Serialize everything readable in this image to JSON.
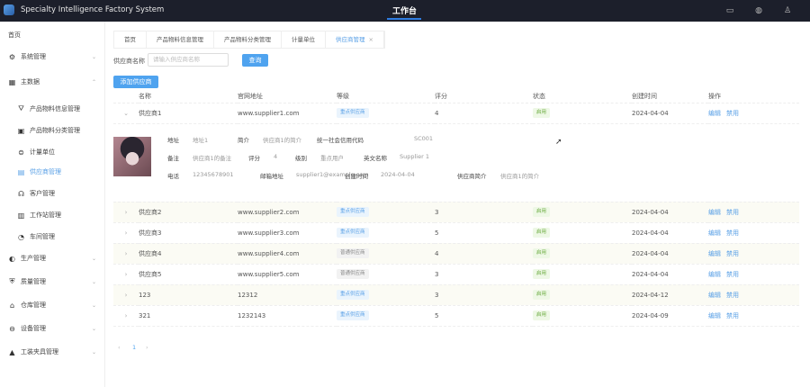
{
  "header": {
    "app_title": "Specialty Intelligence Factory System",
    "center_tab": "工作台",
    "icons": [
      "screen-icon",
      "globe-icon",
      "user-icon"
    ]
  },
  "sidebar": {
    "items": [
      {
        "label": "首页",
        "icon": ""
      },
      {
        "label": "系统管理",
        "icon": "gear-icon",
        "chev": "⌄"
      },
      {
        "label": "主数据",
        "icon": "grid-icon",
        "chev": "⌃"
      },
      {
        "label": "产品物料信息管理",
        "icon": "filter-icon",
        "sub": true
      },
      {
        "label": "产品物料分类管理",
        "icon": "folder-icon",
        "sub": true
      },
      {
        "label": "计量单位",
        "icon": "database-icon",
        "sub": true
      },
      {
        "label": "供应商管理",
        "icon": "supplier-icon",
        "sub": true,
        "active": true
      },
      {
        "label": "客户管理",
        "icon": "headset-icon",
        "sub": true
      },
      {
        "label": "工作站管理",
        "icon": "workstation-icon",
        "sub": true
      },
      {
        "label": "车间管理",
        "icon": "dashboard-icon",
        "sub": true
      },
      {
        "label": "生产管理",
        "icon": "toggle-icon",
        "chev": "⌄"
      },
      {
        "label": "质量管理",
        "icon": "shield-icon",
        "chev": "⌄"
      },
      {
        "label": "仓库管理",
        "icon": "warehouse-icon",
        "chev": "⌄"
      },
      {
        "label": "设备管理",
        "icon": "device-icon",
        "chev": "⌄"
      },
      {
        "label": "工装夹具管理",
        "icon": "tool-icon",
        "chev": "⌄"
      }
    ]
  },
  "tabs": [
    {
      "label": "首页"
    },
    {
      "label": "产品物料信息管理"
    },
    {
      "label": "产品物料分类管理"
    },
    {
      "label": "计量单位"
    },
    {
      "label": "供应商管理",
      "active": true
    }
  ],
  "search": {
    "label": "供应商名称",
    "placeholder": "请输入供应商名称",
    "button": "查询"
  },
  "add_button": "添加供应商",
  "table": {
    "headers": [
      "名称",
      "官网地址",
      "等级",
      "评分",
      "状态",
      "创建时间",
      "操作"
    ],
    "rows": [
      {
        "name": "供应商1",
        "url": "www.supplier1.com",
        "level": "重点供应商",
        "level_type": "key",
        "rating": "4",
        "status": "启用",
        "created": "2024-04-04",
        "expanded": true
      },
      {
        "name": "供应商2",
        "url": "www.supplier2.com",
        "level": "重点供应商",
        "level_type": "key",
        "rating": "3",
        "status": "启用",
        "created": "2024-04-04"
      },
      {
        "name": "供应商3",
        "url": "www.supplier3.com",
        "level": "重点供应商",
        "level_type": "key",
        "rating": "5",
        "status": "启用",
        "created": "2024-04-04"
      },
      {
        "name": "供应商4",
        "url": "www.supplier4.com",
        "level": "普通供应商",
        "level_type": "norm",
        "rating": "4",
        "status": "启用",
        "created": "2024-04-04"
      },
      {
        "name": "供应商5",
        "url": "www.supplier5.com",
        "level": "普通供应商",
        "level_type": "norm",
        "rating": "3",
        "status": "启用",
        "created": "2024-04-04"
      },
      {
        "name": "123",
        "url": "12312",
        "level": "重点供应商",
        "level_type": "key",
        "rating": "3",
        "status": "启用",
        "created": "2024-04-12"
      },
      {
        "name": "321",
        "url": "1232143",
        "level": "重点供应商",
        "level_type": "key",
        "rating": "5",
        "status": "启用",
        "created": "2024-04-09"
      }
    ],
    "actions": {
      "edit": "编辑",
      "disable": "禁用"
    }
  },
  "detail": {
    "address_label": "地址",
    "address": "地址1",
    "intro_label": "简介",
    "intro": "供应商1的简介",
    "credit_label": "统一社会信用代码",
    "credit": "SC001",
    "remark_label": "备注",
    "remark": "供应商1的备注",
    "rating_label": "评分",
    "rating": "4",
    "level_label": "级别",
    "level": "重点用户",
    "en_label": "英文名称",
    "en": "Supplier 1",
    "phone_label": "电话",
    "phone": "12345678901",
    "email_label": "邮箱地址",
    "email": "supplier1@example.com",
    "created_label": "创建时间",
    "created": "2024-04-04",
    "supintro_label": "供应商简介",
    "supintro": "供应商1的简介"
  },
  "pagination": {
    "prev": "‹",
    "current": "1",
    "next": "›"
  }
}
